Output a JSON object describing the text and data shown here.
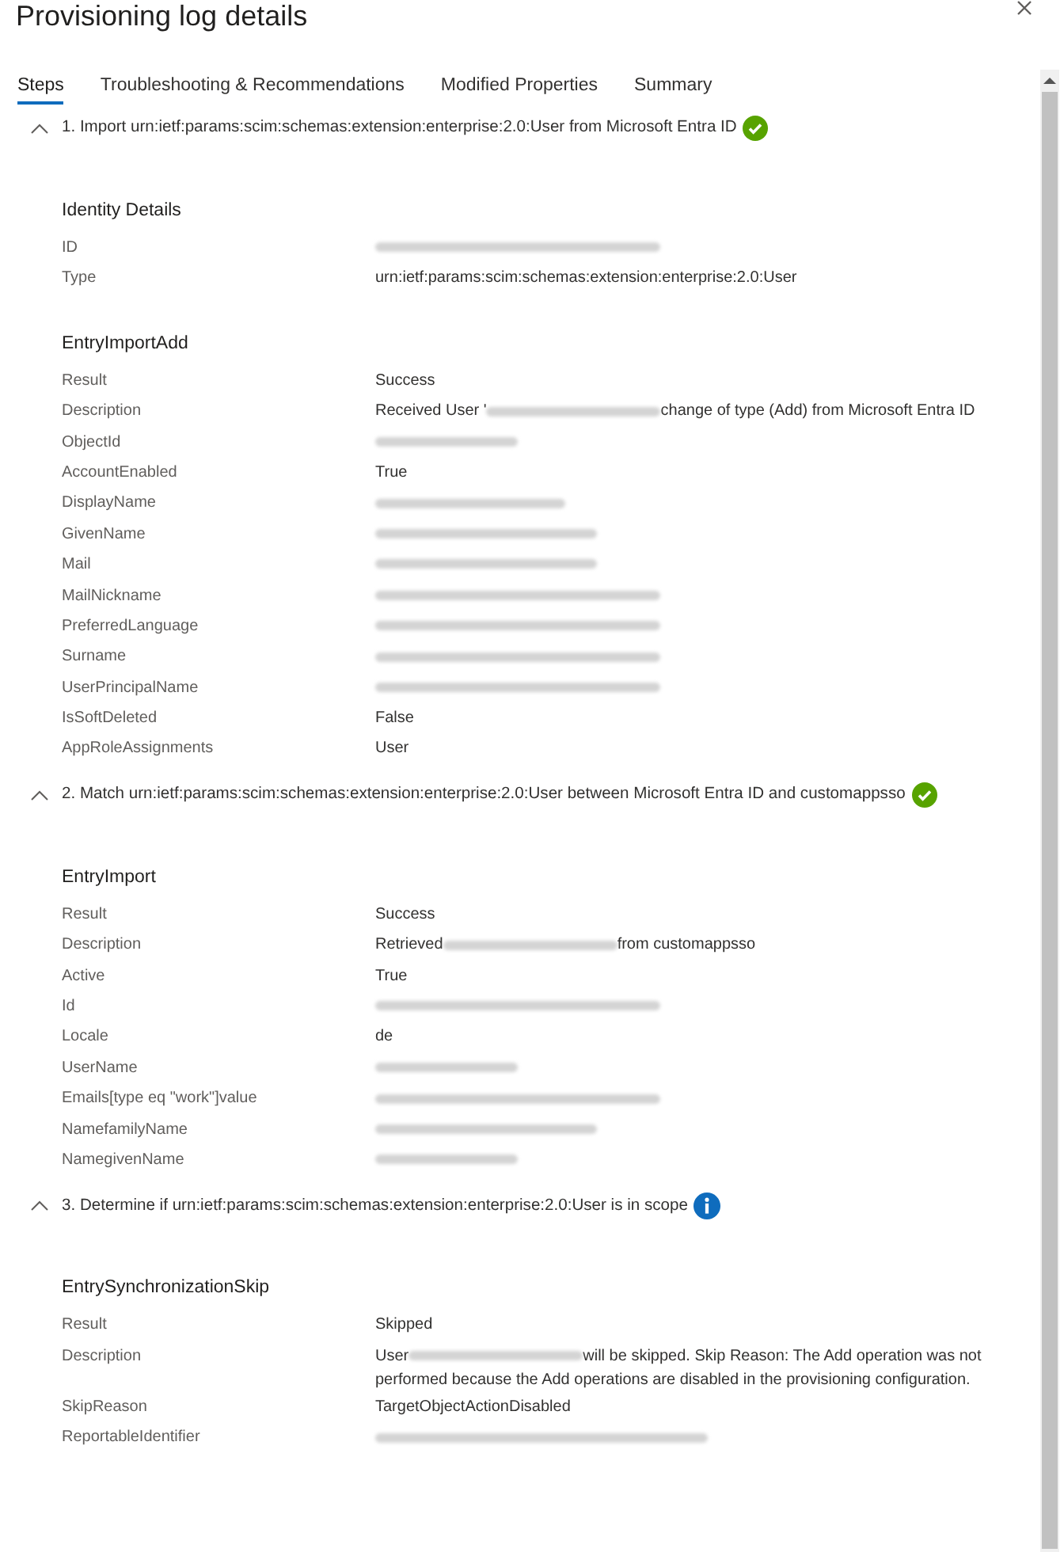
{
  "window": {
    "title": "Provisioning log details"
  },
  "tabs": [
    {
      "label": "Steps",
      "selected": true
    },
    {
      "label": "Troubleshooting & Recommendations",
      "selected": false
    },
    {
      "label": "Modified Properties",
      "selected": false
    },
    {
      "label": "Summary",
      "selected": false
    }
  ],
  "steps": [
    {
      "title": "1. Import urn:ietf:params:scim:schemas:extension:enterprise:2.0:User from Microsoft Entra ID",
      "kind": "success",
      "expanded": true,
      "sections": [
        {
          "heading": "Identity Details",
          "rows": [
            {
              "label": "ID",
              "kind": "redacted"
            },
            {
              "label": "Type",
              "kind": "text",
              "value": "urn:ietf:params:scim:schemas:extension:enterprise:2.0:User"
            }
          ]
        },
        {
          "heading": "EntryImportAdd",
          "rows": [
            {
              "label": "Result",
              "kind": "text",
              "value": "Success"
            },
            {
              "label": "Description",
              "kind": "partly_redacted",
              "before": "Received User '",
              "after": "change of type (Add) from Microsoft Entra ID"
            },
            {
              "label": "ObjectId",
              "kind": "redacted"
            },
            {
              "label": "AccountEnabled",
              "kind": "text",
              "value": "True"
            },
            {
              "label": "DisplayName",
              "kind": "redacted"
            },
            {
              "label": "GivenName",
              "kind": "redacted"
            },
            {
              "label": "Mail",
              "kind": "redacted"
            },
            {
              "label": "MailNickname",
              "kind": "redacted"
            },
            {
              "label": "PreferredLanguage",
              "kind": "redacted"
            },
            {
              "label": "Surname",
              "kind": "redacted"
            },
            {
              "label": "UserPrincipalName",
              "kind": "redacted"
            },
            {
              "label": "IsSoftDeleted",
              "kind": "text",
              "value": "False"
            },
            {
              "label": "AppRoleAssignments",
              "kind": "text",
              "value": "User"
            }
          ]
        }
      ]
    },
    {
      "title": "2. Match urn:ietf:params:scim:schemas:extension:enterprise:2.0:User between Microsoft Entra ID and customappsso",
      "kind": "success",
      "expanded": true,
      "sections": [
        {
          "heading": "EntryImport",
          "rows": [
            {
              "label": "Result",
              "kind": "text",
              "value": "Success"
            },
            {
              "label": "Description",
              "kind": "partly_redacted",
              "before": "Retrieved",
              "after": "from customappsso"
            },
            {
              "label": "Active",
              "kind": "text",
              "value": "True"
            },
            {
              "label": "Id",
              "kind": "redacted"
            },
            {
              "label": "Locale",
              "kind": "text",
              "value": "de"
            },
            {
              "label": "UserName",
              "kind": "redacted"
            },
            {
              "label": "Emails[type eq \"work\"]value",
              "kind": "redacted"
            },
            {
              "label": "NamefamilyName",
              "kind": "redacted"
            },
            {
              "label": "NamegivenName",
              "kind": "redacted"
            }
          ]
        }
      ]
    },
    {
      "title": "3. Determine if urn:ietf:params:scim:schemas:extension:enterprise:2.0:User is in scope",
      "kind": "info",
      "expanded": true,
      "sections": [
        {
          "heading": "EntrySynchronizationSkip",
          "rows": [
            {
              "label": "Result",
              "kind": "text",
              "value": "Skipped"
            },
            {
              "label": "Description",
              "kind": "partly_redacted",
              "before": "User",
              "after": "will be skipped. Skip Reason: The Add operation was not performed because the Add operations are disabled in the provisioning configuration."
            },
            {
              "label": "SkipReason",
              "kind": "text",
              "value": "TargetObjectActionDisabled"
            },
            {
              "label": "ReportableIdentifier",
              "kind": "redacted"
            }
          ]
        }
      ]
    }
  ]
}
